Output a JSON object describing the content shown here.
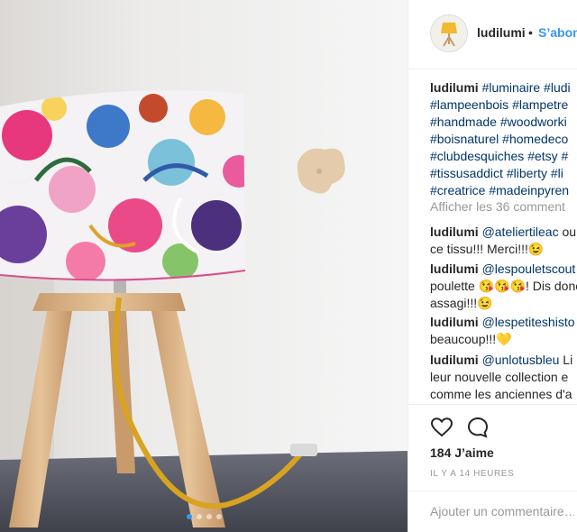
{
  "post": {
    "username": "ludilumi",
    "separator": "•",
    "follow_label": "S’abonner",
    "caption_lines": [
      [
        "#luminaire",
        "#ludi"
      ],
      [
        "#lampeenbois",
        "#lampetre"
      ],
      [
        "#handmade",
        "#woodworki"
      ],
      [
        "#boisnaturel",
        "#homedeco"
      ],
      [
        "#clubdesquiches",
        "#etsy",
        "#"
      ],
      [
        "#tissusaddict",
        "#liberty",
        "#li"
      ],
      [
        "#creatrice",
        "#madeinpyren"
      ]
    ],
    "more_comments": "Afficher les 36 comment",
    "comments": [
      {
        "user": "ludilumi",
        "mention": "@ateliertileac",
        "lines": [
          "ou",
          "ce tissu!!! Merci!!!😉"
        ]
      },
      {
        "user": "ludilumi",
        "mention": "@lespouletscout",
        "lines": [
          "",
          "poulette 😘😘😘! Dis donc",
          "assagi!!!😉"
        ]
      },
      {
        "user": "ludilumi",
        "mention": "@lespetiteshisto",
        "lines": [
          "",
          "beaucoup!!!💛"
        ]
      },
      {
        "user": "ludilumi",
        "mention": "@unlotusbleu",
        "lines": [
          "Li",
          "leur nouvelle collection e",
          "comme les anciennes d'a"
        ]
      }
    ],
    "likes": "184 J’aime",
    "time": "IL Y A 14 HEURES",
    "comment_placeholder": "Ajouter un commentaire…"
  },
  "carousel": {
    "count": 4,
    "active": 0
  },
  "colors": {
    "accent": "#3897f0",
    "hashtag": "#003569",
    "muted": "#999999"
  },
  "icons": {
    "like": "heart-icon",
    "comment": "comment-bubble-icon"
  }
}
